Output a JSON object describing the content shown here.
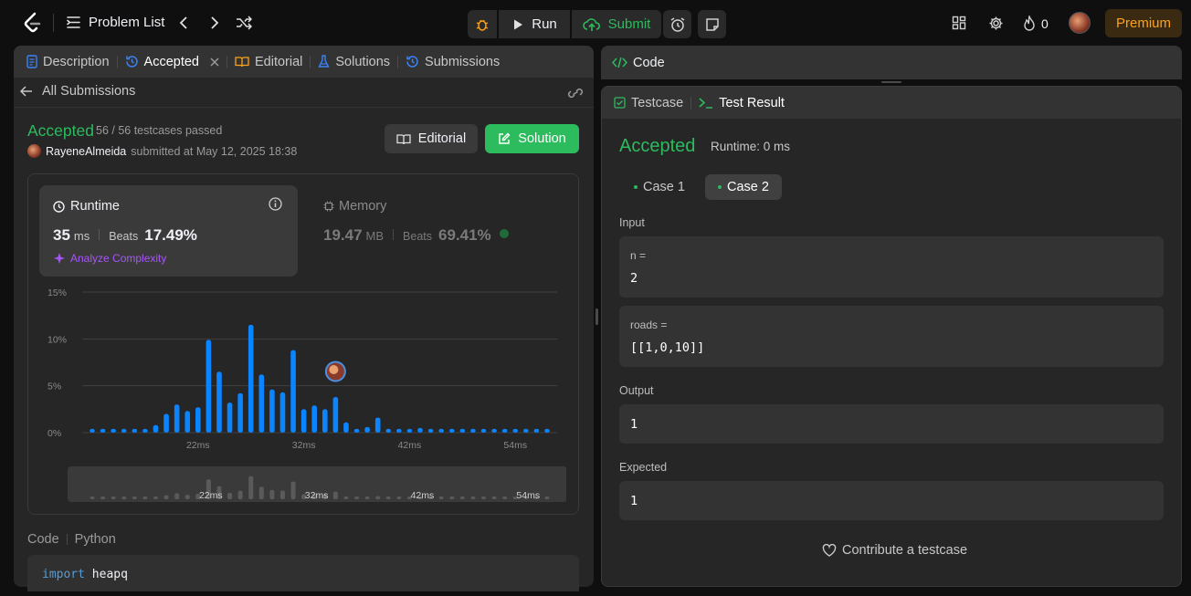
{
  "topbar": {
    "problem_list": "Problem List",
    "run": "Run",
    "submit": "Submit",
    "streak_count": "0",
    "premium": "Premium"
  },
  "left_tabs": {
    "description": "Description",
    "accepted": "Accepted",
    "editorial": "Editorial",
    "solutions": "Solutions",
    "submissions": "Submissions"
  },
  "submission": {
    "back_label": "All Submissions",
    "status": "Accepted",
    "testcases": "56 / 56 testcases passed",
    "username": "RayeneAlmeida",
    "submitted_text": "submitted at May 12, 2025 18:38",
    "editorial_btn": "Editorial",
    "solution_btn": "Solution"
  },
  "runtime": {
    "label": "Runtime",
    "value": "35",
    "unit": "ms",
    "beats_label": "Beats",
    "beats": "17.49%",
    "analyze": "Analyze Complexity"
  },
  "memory": {
    "label": "Memory",
    "value": "19.47",
    "unit": "MB",
    "beats_label": "Beats",
    "beats": "69.41%"
  },
  "chart_data": {
    "type": "bar",
    "xlabel": "",
    "ylabel": "",
    "ylim": [
      0,
      15
    ],
    "yticks": [
      "0%",
      "5%",
      "10%",
      "15%"
    ],
    "xticks": [
      "22ms",
      "32ms",
      "42ms",
      "54ms"
    ],
    "xtick_indices": [
      10,
      20,
      30,
      40
    ],
    "user_index": 23,
    "values": [
      0.4,
      0.4,
      0.4,
      0.4,
      0.4,
      0.4,
      0.8,
      2.0,
      3.0,
      2.3,
      2.7,
      9.9,
      6.5,
      3.2,
      4.2,
      11.5,
      6.2,
      4.6,
      4.3,
      8.8,
      2.5,
      2.9,
      2.5,
      3.8,
      1.1,
      0.4,
      0.6,
      1.6,
      0.4,
      0.4,
      0.4,
      0.5,
      0.4,
      0.4,
      0.4,
      0.4,
      0.4,
      0.4,
      0.4,
      0.4,
      0.4,
      0.4,
      0.4,
      0.4
    ]
  },
  "code": {
    "label": "Code",
    "language": "Python",
    "line1_keyword": "import",
    "line1_rest": " heapq"
  },
  "right": {
    "code_tab": "Code",
    "testcase_tab": "Testcase",
    "result_tab": "Test Result",
    "status": "Accepted",
    "runtime": "Runtime: 0 ms",
    "case1": "Case 1",
    "case2": "Case 2",
    "input_label": "Input",
    "n_label": "n =",
    "n_value": "2",
    "roads_label": "roads =",
    "roads_value": "[[1,0,10]]",
    "output_label": "Output",
    "output_value": "1",
    "expected_label": "Expected",
    "expected_value": "1",
    "contribute": "Contribute a testcase"
  },
  "colors": {
    "accent_green": "#2cbb5d",
    "bar_blue": "#0a84ff",
    "premium_orange": "#ffa116"
  }
}
